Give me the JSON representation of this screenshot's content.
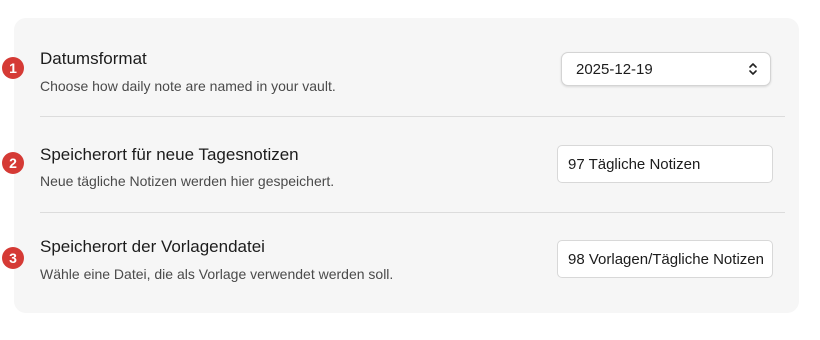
{
  "settings": {
    "rows": [
      {
        "badge": "1",
        "title": "Datumsformat",
        "description": "Choose how daily note are named in your vault.",
        "control": "select",
        "value": "2025-12-19"
      },
      {
        "badge": "2",
        "title": "Speicherort für neue Tagesnotizen",
        "description": "Neue tägliche Notizen werden hier gespeichert.",
        "control": "text",
        "value": "97 Tägliche Notizen"
      },
      {
        "badge": "3",
        "title": "Speicherort der Vorlagendatei",
        "description": "Wähle eine Datei, die als Vorlage verwendet werden soll.",
        "control": "text",
        "value": "98 Vorlagen/Tägliche Notizen"
      }
    ]
  },
  "colors": {
    "badge": "#d53a35",
    "panel": "#f6f6f6"
  },
  "icons": {
    "select_chevron": "chevron-up-down-icon"
  }
}
